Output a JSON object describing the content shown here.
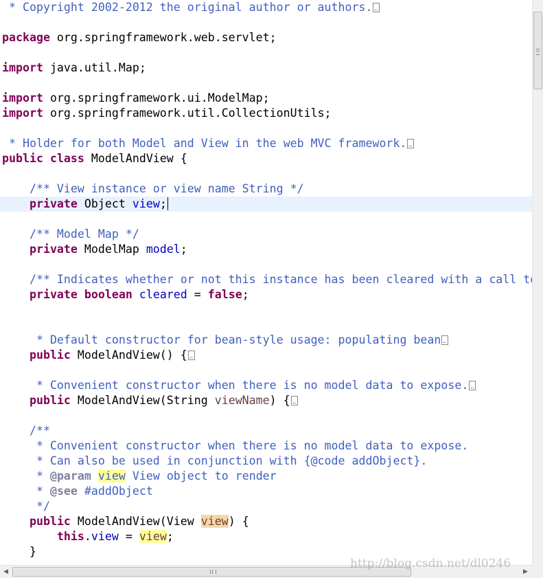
{
  "editor": {
    "lines": {
      "l1": {
        "comment": " * Copyright 2002-2012 the original author or authors."
      },
      "l2": {
        "kw": "package",
        "text": " org.springframework.web.servlet;"
      },
      "l3": {
        "kw": "import",
        "text": " java.util.Map;"
      },
      "l4": {
        "kw": "import",
        "text": " org.springframework.ui.ModelMap;"
      },
      "l5": {
        "kw": "import",
        "text": " org.springframework.util.CollectionUtils;"
      },
      "l6": {
        "comment": " * Holder for both Model and View in the web MVC framework."
      },
      "l7": {
        "kw1": "public",
        "kw2": "class",
        "text": " ModelAndView {"
      },
      "l8": {
        "comment": "/** View instance or view name String */"
      },
      "l9": {
        "kw": "private",
        "type": " Object ",
        "field": "view",
        "end": ";"
      },
      "l10": {
        "comment": "/** Model Map */"
      },
      "l11": {
        "kw": "private",
        "type": " ModelMap ",
        "field": "model",
        "end": ";"
      },
      "l12": {
        "comment": "/** Indicates whether or not this instance has been cleared with a call to"
      },
      "l13": {
        "kw1": "private",
        "kw2": "boolean",
        "field": "cleared",
        "op": " = ",
        "kw3": "false",
        "end": ";"
      },
      "l14": {
        "comment": " * Default constructor for bean-style usage: populating bean"
      },
      "l15": {
        "kw": "public",
        "text": " ModelAndView() {"
      },
      "l16": {
        "comment": " * Convenient constructor when there is no model data to expose."
      },
      "l17": {
        "kw": "public",
        "text": " ModelAndView(String ",
        "param": "viewName",
        "end": ") {"
      },
      "l18": {
        "comment": "/**"
      },
      "l19": {
        "comment": " * Convenient constructor when there is no model data to expose."
      },
      "l20": {
        "comment": " * Can also be used in conjunction with {@code addObject}."
      },
      "l21": {
        "prefix": " * ",
        "tag": "@param",
        "sp": " ",
        "hl": "view",
        "rest": " View object to render"
      },
      "l22": {
        "prefix": " * ",
        "tag": "@see",
        "rest": " #addObject"
      },
      "l23": {
        "comment": " */"
      },
      "l24": {
        "kw": "public",
        "text": " ModelAndView(View ",
        "param": "view",
        "end": ") {"
      },
      "l25": {
        "kw": "this",
        "dot": ".",
        "field": "view",
        "op": " = ",
        "var": "view",
        "end": ";"
      },
      "l26": {
        "text": "}"
      }
    }
  },
  "colors": {
    "keyword": "#7f0055",
    "comment": "#3f5fbf",
    "javadoc_tag": "#7f7f9f",
    "field": "#0000c0",
    "local_variable": "#6a3e3e",
    "occurrence_highlight": "#ffff99",
    "write_occurrence_highlight": "#f6d8a8",
    "current_line": "#e8f2fe"
  },
  "watermark": "http://blog.csdn.net/dl0246"
}
